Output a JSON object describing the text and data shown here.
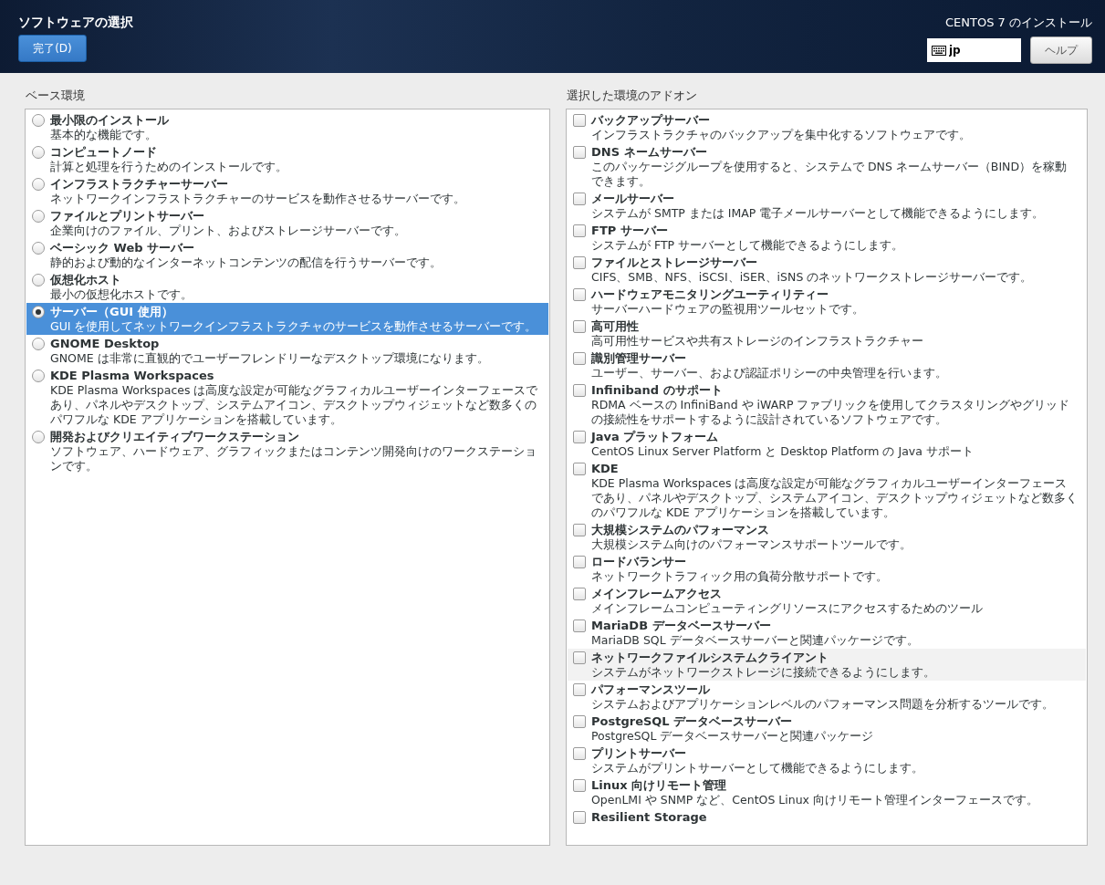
{
  "header": {
    "title": "ソフトウェアの選択",
    "done_button": "完了(D)",
    "product": "CENTOS 7 のインストール",
    "keyboard_layout": "jp",
    "help_button": "ヘルプ"
  },
  "base_environment": {
    "label": "ベース環境",
    "items": [
      {
        "title": "最小限のインストール",
        "description": "基本的な機能です。",
        "selected": false
      },
      {
        "title": "コンピュートノード",
        "description": "計算と処理を行うためのインストールです。",
        "selected": false
      },
      {
        "title": "インフラストラクチャーサーバー",
        "description": "ネットワークインフラストラクチャーのサービスを動作させるサーバーです。",
        "selected": false
      },
      {
        "title": "ファイルとプリントサーバー",
        "description": "企業向けのファイル、プリント、およびストレージサーバーです。",
        "selected": false
      },
      {
        "title": "ベーシック Web サーバー",
        "description": "静的および動的なインターネットコンテンツの配信を行うサーバーです。",
        "selected": false
      },
      {
        "title": "仮想化ホスト",
        "description": "最小の仮想化ホストです。",
        "selected": false
      },
      {
        "title": "サーバー（GUI 使用）",
        "description": "GUI を使用してネットワークインフラストラクチャのサービスを動作させるサーバーです。",
        "selected": true
      },
      {
        "title": "GNOME Desktop",
        "description": "GNOME は非常に直観的でユーザーフレンドリーなデスクトップ環境になります。",
        "selected": false
      },
      {
        "title": "KDE Plasma Workspaces",
        "description": "KDE Plasma Workspaces は高度な設定が可能なグラフィカルユーザーインターフェースであり、パネルやデスクトップ、システムアイコン、デスクトップウィジェットなど数多くのパワフルな KDE アプリケーションを搭載しています。",
        "selected": false
      },
      {
        "title": "開発およびクリエイティブワークステーション",
        "description": "ソフトウェア、ハードウェア、グラフィックまたはコンテンツ開発向けのワークステーションです。",
        "selected": false
      }
    ]
  },
  "addons": {
    "label": "選択した環境のアドオン",
    "items": [
      {
        "title": "バックアップサーバー",
        "description": "インフラストラクチャのバックアップを集中化するソフトウェアです。",
        "checked": false,
        "hovered": false
      },
      {
        "title": "DNS ネームサーバー",
        "description": "このパッケージグループを使用すると、システムで DNS ネームサーバー（BIND）を稼動できます。",
        "checked": false,
        "hovered": false
      },
      {
        "title": "メールサーバー",
        "description": "システムが SMTP または IMAP 電子メールサーバーとして機能できるようにします。",
        "checked": false,
        "hovered": false
      },
      {
        "title": "FTP サーバー",
        "description": "システムが FTP サーバーとして機能できるようにします。",
        "checked": false,
        "hovered": false
      },
      {
        "title": "ファイルとストレージサーバー",
        "description": "CIFS、SMB、NFS、iSCSI、iSER、iSNS のネットワークストレージサーバーです。",
        "checked": false,
        "hovered": false
      },
      {
        "title": "ハードウェアモニタリングユーティリティー",
        "description": "サーバーハードウェアの監視用ツールセットです。",
        "checked": false,
        "hovered": false
      },
      {
        "title": "高可用性",
        "description": "高可用性サービスや共有ストレージのインフラストラクチャー",
        "checked": false,
        "hovered": false
      },
      {
        "title": "識別管理サーバー",
        "description": "ユーザー、サーバー、および認証ポリシーの中央管理を行います。",
        "checked": false,
        "hovered": false
      },
      {
        "title": "Infiniband のサポート",
        "description": "RDMA ベースの InfiniBand や iWARP ファブリックを使用してクラスタリングやグリッドの接続性をサポートするように設計されているソフトウェアです。",
        "checked": false,
        "hovered": false
      },
      {
        "title": "Java プラットフォーム",
        "description": "CentOS Linux Server Platform と Desktop Platform の Java サポート",
        "checked": false,
        "hovered": false
      },
      {
        "title": "KDE",
        "description": "KDE Plasma Workspaces は高度な設定が可能なグラフィカルユーザーインターフェースであり、パネルやデスクトップ、システムアイコン、デスクトップウィジェットなど数多くのパワフルな KDE アプリケーションを搭載しています。",
        "checked": false,
        "hovered": false
      },
      {
        "title": "大規模システムのパフォーマンス",
        "description": "大規模システム向けのパフォーマンスサポートツールです。",
        "checked": false,
        "hovered": false
      },
      {
        "title": "ロードバランサー",
        "description": "ネットワークトラフィック用の負荷分散サポートです。",
        "checked": false,
        "hovered": false
      },
      {
        "title": "メインフレームアクセス",
        "description": "メインフレームコンピューティングリソースにアクセスするためのツール",
        "checked": false,
        "hovered": false
      },
      {
        "title": "MariaDB データベースサーバー",
        "description": "MariaDB SQL データベースサーバーと関連パッケージです。",
        "checked": false,
        "hovered": false
      },
      {
        "title": "ネットワークファイルシステムクライアント",
        "description": "システムがネットワークストレージに接続できるようにします。",
        "checked": false,
        "hovered": true
      },
      {
        "title": "パフォーマンスツール",
        "description": "システムおよびアプリケーションレベルのパフォーマンス問題を分析するツールです。",
        "checked": false,
        "hovered": false
      },
      {
        "title": "PostgreSQL データベースサーバー",
        "description": "PostgreSQL データベースサーバーと関連パッケージ",
        "checked": false,
        "hovered": false
      },
      {
        "title": "プリントサーバー",
        "description": "システムがプリントサーバーとして機能できるようにします。",
        "checked": false,
        "hovered": false
      },
      {
        "title": "Linux 向けリモート管理",
        "description": "OpenLMI や SNMP など、CentOS Linux 向けリモート管理インターフェースです。",
        "checked": false,
        "hovered": false
      },
      {
        "title": "Resilient Storage",
        "checked": false,
        "hovered": false
      }
    ]
  }
}
